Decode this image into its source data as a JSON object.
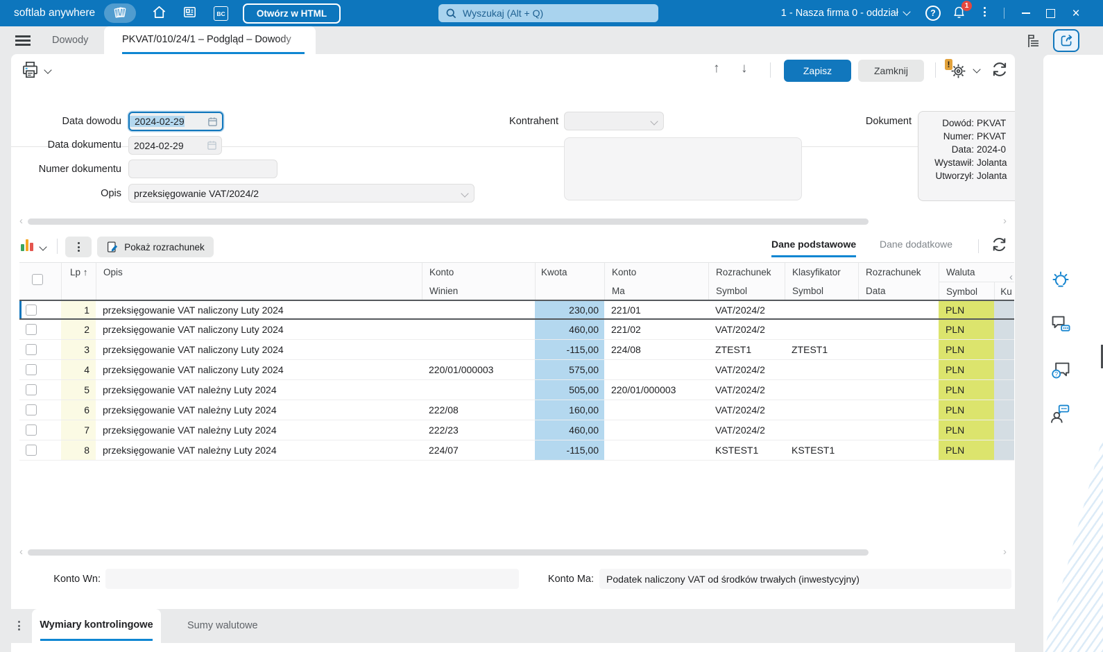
{
  "colors": {
    "titlebar": "#0d76bd",
    "accent": "#0f86d2",
    "primary_button": "#1177bd",
    "badge": "#e5483f",
    "search_bg": "#a9d3ee",
    "search_text": "#1e6091",
    "kwota_bg": "#b4d8ef",
    "lp_bg": "#fbfae4",
    "waluta_bg": "#dce46d",
    "kurs_bg": "#d4dde3"
  },
  "titlebar": {
    "app_name": "softlab anywhere",
    "bc_label": "BC",
    "open_html_button": "Otwórz w HTML",
    "search_placeholder": "Wyszukaj (Alt + Q)",
    "company_selector": "1 - Nasza firma 0 - oddział",
    "notification_count": "1"
  },
  "tabbar": {
    "tabs": [
      {
        "label": "Dowody",
        "active": false
      },
      {
        "label": "PKVAT/010/24/1 – Podgląd – Dowody",
        "active": true
      }
    ]
  },
  "toolbar": {
    "save_label": "Zapisz",
    "close_label": "Zamknij",
    "warning_glyph": "!"
  },
  "form": {
    "data_dowodu": {
      "label": "Data dowodu",
      "value": "2024-02-29"
    },
    "data_dokumentu": {
      "label": "Data dokumentu",
      "value": "2024-02-29"
    },
    "numer_dokumentu": {
      "label": "Numer dokumentu",
      "value": ""
    },
    "opis": {
      "label": "Opis",
      "value": "przeksięgowanie  VAT/2024/2"
    },
    "kontrahent": {
      "label": "Kontrahent",
      "value": ""
    },
    "dokument": {
      "label": "Dokument",
      "lines": [
        {
          "label": "Dowód:",
          "value": "PKVAT"
        },
        {
          "label": "Numer:",
          "value": "PKVAT"
        },
        {
          "label": "Data:",
          "value": "2024-0"
        },
        {
          "label": "Wystawił:",
          "value": "Jolanta"
        },
        {
          "label": "Utworzył:",
          "value": "Jolanta"
        }
      ]
    }
  },
  "grid": {
    "toolbar": {
      "show_settlement_label": "Pokaż rozrachunek"
    },
    "view_tabs": [
      {
        "label": "Dane podstawowe",
        "active": true
      },
      {
        "label": "Dane dodatkowe",
        "active": false
      }
    ],
    "header": {
      "lp": "Lp",
      "sort_arrow": "↑",
      "opis": "Opis",
      "konto_winien": [
        "Konto",
        "Winien"
      ],
      "kwota": "Kwota",
      "konto_ma": [
        "Konto",
        "Ma"
      ],
      "rozrachunek_symbol": [
        "Rozrachunek",
        "Symbol"
      ],
      "klasyfikator_symbol": [
        "Klasyfikator",
        "Symbol"
      ],
      "rozrachunek_data": [
        "Rozrachunek",
        "Data"
      ],
      "waluta": "Waluta",
      "waluta_symbol": "Symbol",
      "kurs": "Ku"
    },
    "rows": [
      {
        "lp": "1",
        "opis": "przeksięgowanie VAT naliczony Luty 2024",
        "winien": "",
        "kwota": "230,00",
        "ma": "221/01",
        "roz_symbol": "VAT/2024/2",
        "klas_symbol": "",
        "roz_data": "",
        "waluta": "PLN",
        "selected": true
      },
      {
        "lp": "2",
        "opis": "przeksięgowanie VAT naliczony Luty 2024",
        "winien": "",
        "kwota": "460,00",
        "ma": "221/02",
        "roz_symbol": "VAT/2024/2",
        "klas_symbol": "",
        "roz_data": "",
        "waluta": "PLN",
        "selected": false
      },
      {
        "lp": "3",
        "opis": "przeksięgowanie VAT naliczony Luty 2024",
        "winien": "",
        "kwota": "-115,00",
        "ma": "224/08",
        "roz_symbol": "ZTEST1",
        "klas_symbol": "ZTEST1",
        "roz_data": "",
        "waluta": "PLN",
        "selected": false
      },
      {
        "lp": "4",
        "opis": "przeksięgowanie VAT naliczony Luty 2024",
        "winien": "220/01/000003",
        "kwota": "575,00",
        "ma": "",
        "roz_symbol": "VAT/2024/2",
        "klas_symbol": "",
        "roz_data": "",
        "waluta": "PLN",
        "selected": false
      },
      {
        "lp": "5",
        "opis": "przeksięgowanie VAT należny Luty 2024",
        "winien": "",
        "kwota": "505,00",
        "ma": "220/01/000003",
        "roz_symbol": "VAT/2024/2",
        "klas_symbol": "",
        "roz_data": "",
        "waluta": "PLN",
        "selected": false
      },
      {
        "lp": "6",
        "opis": "przeksięgowanie VAT należny Luty 2024",
        "winien": "222/08",
        "kwota": "160,00",
        "ma": "",
        "roz_symbol": "VAT/2024/2",
        "klas_symbol": "",
        "roz_data": "",
        "waluta": "PLN",
        "selected": false
      },
      {
        "lp": "7",
        "opis": "przeksięgowanie VAT należny Luty 2024",
        "winien": "222/23",
        "kwota": "460,00",
        "ma": "",
        "roz_symbol": "VAT/2024/2",
        "klas_symbol": "",
        "roz_data": "",
        "waluta": "PLN",
        "selected": false
      },
      {
        "lp": "8",
        "opis": "przeksięgowanie VAT należny Luty 2024",
        "winien": "224/07",
        "kwota": "-115,00",
        "ma": "",
        "roz_symbol": "KSTEST1",
        "klas_symbol": "KSTEST1",
        "roz_data": "",
        "waluta": "PLN",
        "selected": false
      }
    ]
  },
  "footer": {
    "konto_wn_label": "Konto Wn:",
    "konto_wn_value": "",
    "konto_ma_label": "Konto Ma:",
    "konto_ma_value": "Podatek naliczony VAT od środków trwałych (inwestycyjny)"
  },
  "bottom_tabs": [
    {
      "label": "Wymiary kontrolingowe",
      "active": true
    },
    {
      "label": "Sumy walutowe",
      "active": false
    }
  ]
}
